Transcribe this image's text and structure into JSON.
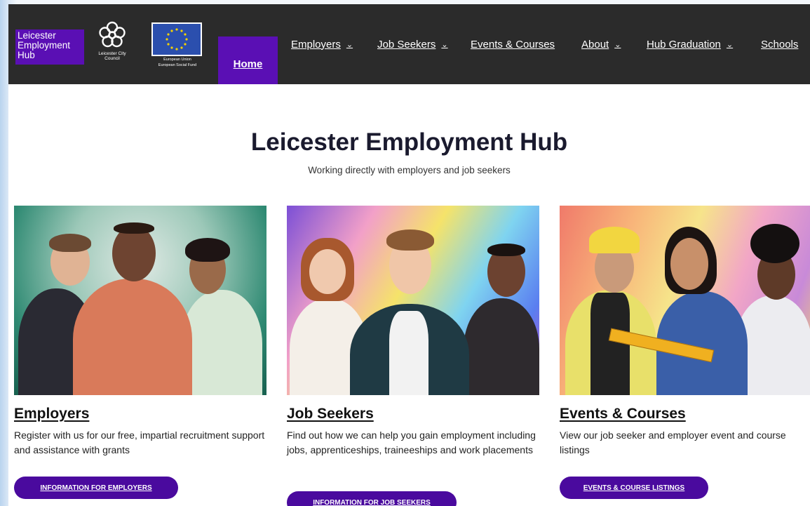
{
  "header": {
    "brand_logo_text": "Leicester Employment Hub",
    "council_logo_text": "Leicester City Council",
    "eu_logo_text": "European Union",
    "eu_logo_subtext": "European Social Fund",
    "nav": [
      {
        "label": "Home",
        "active": true,
        "dropdown": false
      },
      {
        "label": "Employers",
        "active": false,
        "dropdown": true
      },
      {
        "label": "Job Seekers",
        "active": false,
        "dropdown": true
      },
      {
        "label": "Events & Courses",
        "active": false,
        "dropdown": false
      },
      {
        "label": "About",
        "active": false,
        "dropdown": true
      },
      {
        "label": "Hub Graduation",
        "active": false,
        "dropdown": true
      },
      {
        "label": "Schools",
        "active": false,
        "dropdown": false
      }
    ]
  },
  "hero": {
    "title": "Leicester Employment Hub",
    "subtitle": "Working directly with employers and job seekers"
  },
  "cards": [
    {
      "title": "Employers",
      "description": "Register with us for our free, impartial recruitment support and assistance with grants",
      "button": "INFORMATION FOR EMPLOYERS"
    },
    {
      "title": "Job Seekers",
      "description": "Find out how we can help you gain employment including jobs, apprenticeships, traineeships and work placements",
      "button": "INFORMATION FOR JOB SEEKERS"
    },
    {
      "title": "Events & Courses",
      "description": "View our job seeker and employer event and course listings",
      "button": "EVENTS & COURSE LISTINGS"
    }
  ],
  "colors": {
    "brand_purple": "#5a0fb4",
    "button_purple": "#4a0a9e",
    "header_bg": "#2b2b2b"
  }
}
